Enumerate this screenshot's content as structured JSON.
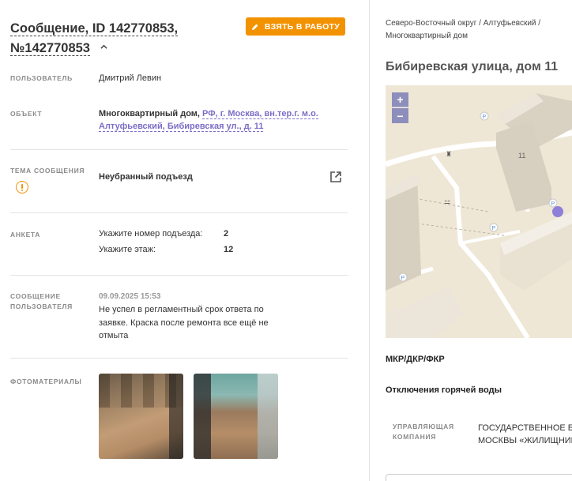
{
  "header": {
    "title_line1": "Сообщение, ID 142770853,",
    "title_line2": "№142770853",
    "take_button": "ВЗЯТЬ В РАБОТУ"
  },
  "user": {
    "label": "ПОЛЬЗОВАТЕЛЬ",
    "value": "Дмитрий Левин"
  },
  "object": {
    "label": "ОБЪЕКТ",
    "type": "Многоквартирный дом,",
    "address_link": "РФ, г. Москва, вн.тер.г. м.о. Алтуфьевский, Бибиревская ул., д. 11"
  },
  "topic": {
    "label": "ТЕМА СООБЩЕНИЯ",
    "value": "Неубранный подъезд"
  },
  "survey": {
    "label": "АНКЕТА",
    "rows": [
      {
        "q": "Укажите номер подъезда:",
        "a": "2"
      },
      {
        "q": "Укажите этаж:",
        "a": "12"
      }
    ]
  },
  "message": {
    "label_line1": "СООБЩЕНИЕ",
    "label_line2": "ПОЛЬЗОВАТЕЛЯ",
    "date": "09.09.2025 15:53",
    "text": "Не успел в регламентный срок ответа по заявке. Краска после ремонта все ещё не отмыта"
  },
  "photos": {
    "label": "ФОТОМАТЕРИАЛЫ"
  },
  "right": {
    "breadcrumb": "Северо-Восточный округ / Алтуфьевский / Многоквартирный дом",
    "address": "Бибиревская улица, дом 11",
    "map": {
      "house_number": "11",
      "zoom_in": "+",
      "zoom_out": "−"
    },
    "mkr": "МКР/ДКР/ФКР",
    "hot_water": "Отключения горячей воды",
    "uk_label_line1": "УПРАВЛЯЮЩАЯ",
    "uk_label_line2": "КОМПАНИЯ",
    "uk_value_line1": "ГОСУДАРСТВЕННОЕ БК",
    "uk_value_line2": "МОСКВЫ «ЖИЛИЩНИК"
  },
  "colors": {
    "accent": "#f39200",
    "link": "#7b6ec7",
    "map_bg": "#efe7d6",
    "marker": "#8e7fd8"
  }
}
